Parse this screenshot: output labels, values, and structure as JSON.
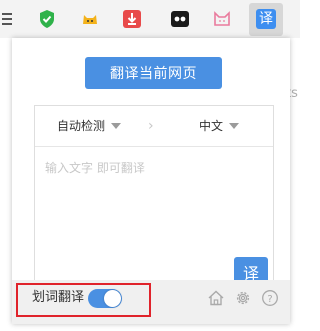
{
  "toolbar": {
    "icons": [
      "menu-icon",
      "shield-check-icon",
      "cat-extension-icon",
      "download-icon",
      "eyes-icon",
      "pink-cat-icon",
      "translate-extension-icon"
    ],
    "translate_icon_glyph": "译"
  },
  "ghost_text": "ts",
  "popup": {
    "translate_page_label": "翻译当前网页",
    "source_language": "自动检测",
    "arrow": "›",
    "target_language": "中文",
    "input_placeholder": "输入文字 即可翻译",
    "input_value": "",
    "submit_label": "译",
    "selection_translate_label": "划词翻译",
    "selection_translate_enabled": true
  },
  "colors": {
    "accent": "#4a90e2",
    "highlight": "#e0232b"
  }
}
